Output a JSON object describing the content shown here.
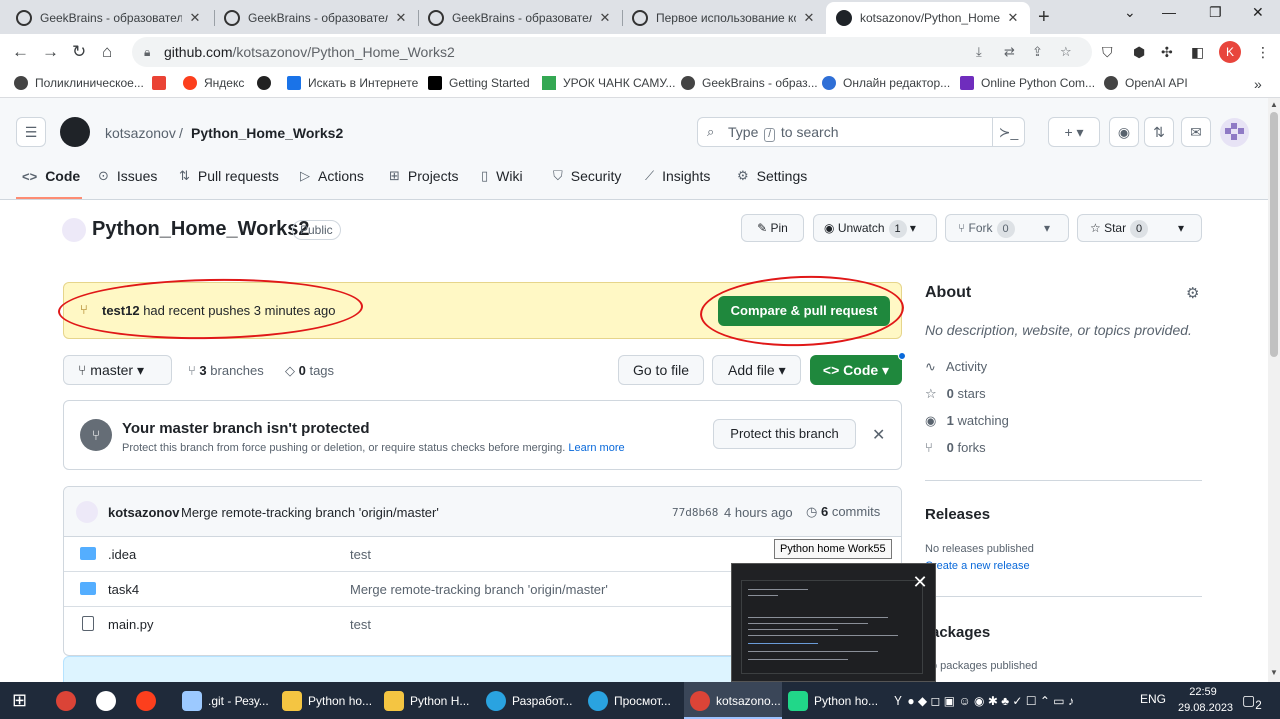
{
  "browser": {
    "tabs": [
      {
        "title": "GeekBrains - образовательн"
      },
      {
        "title": "GeekBrains - образовательн"
      },
      {
        "title": "GeekBrains - образовательн"
      },
      {
        "title": "Первое использование кон"
      },
      {
        "title": "kotsazonov/Python_Home_W"
      }
    ],
    "url_host": "github.com",
    "url_path": "/kotsazonov/Python_Home_Works2",
    "profile_letter": "K",
    "bookmarks": [
      "Поликлиническое...",
      "",
      "Яндекс",
      "",
      "Искать в Интернете",
      "Getting Started",
      "УРОК ЧАНК САМУ...",
      "GeekBrains - образ...",
      "Онлайн редактор...",
      "Online Python Com...",
      "OpenAI API"
    ]
  },
  "github": {
    "owner": "kotsazonov",
    "crumb_sep": "/",
    "repo": "Python_Home_Works2",
    "search_before": "Type",
    "search_key": "/",
    "search_after": "to search",
    "nav": [
      "Code",
      "Issues",
      "Pull requests",
      "Actions",
      "Projects",
      "Wiki",
      "Security",
      "Insights",
      "Settings"
    ],
    "visibility": "Public",
    "pin": "Pin",
    "unwatch": "Unwatch",
    "unwatch_count": "1",
    "fork": "Fork",
    "fork_count": "0",
    "star": "Star",
    "star_count": "0",
    "banner_branch": "test12",
    "banner_text": "had recent pushes 3 minutes ago",
    "compare_btn": "Compare & pull request",
    "branch": "master",
    "branches_count": "3",
    "branches_label": "branches",
    "tags_count": "0",
    "tags_label": "tags",
    "go_to_file": "Go to file",
    "add_file": "Add file",
    "code_btn": "Code",
    "protect_title": "Your master branch isn't protected",
    "protect_sub": "Protect this branch from force pushing or deletion, or require status checks before merging.",
    "learn_more": "Learn more",
    "protect_btn": "Protect this branch",
    "commit_user": "kotsazonov",
    "commit_msg": "Merge remote-tracking branch 'origin/master'",
    "commit_sha": "77d8b68",
    "commit_time": "4 hours ago",
    "commits_count": "6",
    "commits_label": "commits",
    "files": [
      {
        "name": ".idea",
        "msg": "test",
        "kind": "folder"
      },
      {
        "name": "task4",
        "msg": "Merge remote-tracking branch 'origin/master'",
        "kind": "folder"
      },
      {
        "name": "main.py",
        "msg": "test",
        "kind": "file"
      }
    ],
    "about_title": "About",
    "about_desc": "No description, website, or topics provided.",
    "activity": "Activity",
    "stars_count": "0",
    "stars_label": "stars",
    "watching_count": "1",
    "watching_label": "watching",
    "forks_count": "0",
    "forks_label": "forks",
    "releases_title": "Releases",
    "no_releases": "No releases published",
    "create_release": "Create a new release",
    "packages_title": "ackages",
    "no_packages": "o packages published"
  },
  "tooltip": "Python home Work55",
  "taskbar": {
    "items": [
      ".git - Резу...",
      "Python ho...",
      "Python H...",
      "Разработ...",
      "Просмот...",
      "kotsazono...",
      "Python ho..."
    ],
    "lang": "ENG",
    "time": "22:59",
    "date": "29.08.2023",
    "notif_count": "2"
  },
  "colors": {
    "accent_green": "#1f883d",
    "banner_yellow": "#fff8c5",
    "annotation_red": "#e01818",
    "link_blue": "#0969da"
  }
}
